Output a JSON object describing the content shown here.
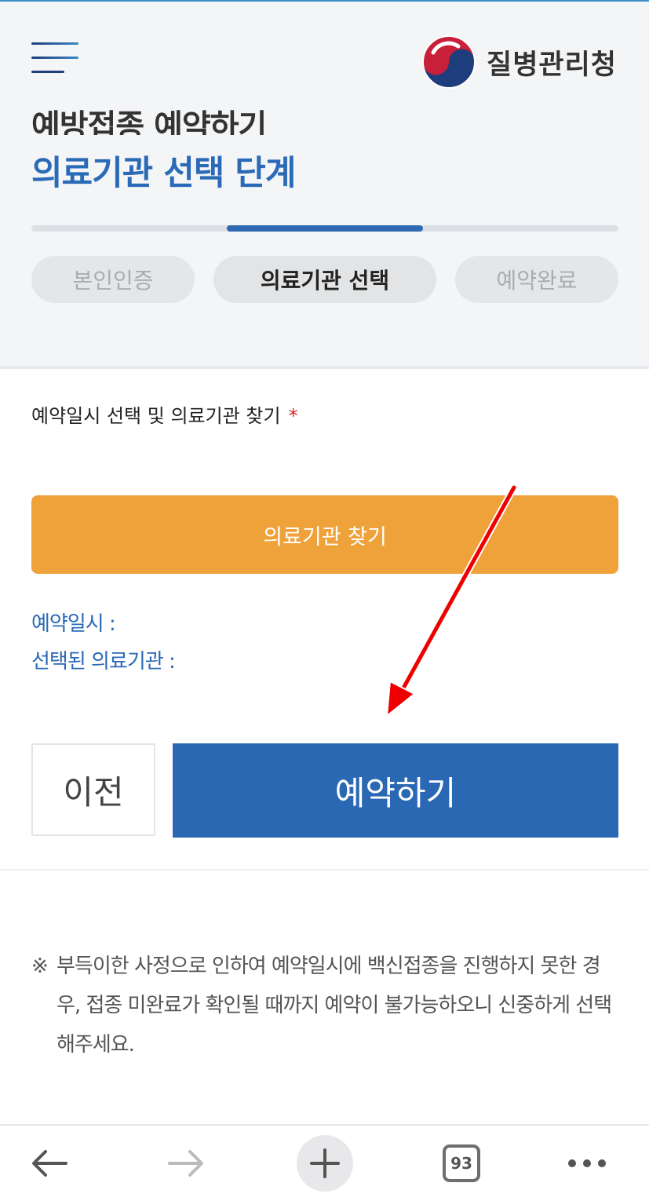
{
  "header": {
    "org_name": "질병관리청",
    "title_partial": "예방접종 예약하기",
    "stage_title": "의료기관 선택 단계"
  },
  "steps": [
    {
      "label": "본인인증",
      "state": "inactive"
    },
    {
      "label": "의료기관 선택",
      "state": "active"
    },
    {
      "label": "예약완료",
      "state": "inactive"
    }
  ],
  "progress": {
    "current_step": 2,
    "total_steps": 3
  },
  "form": {
    "section_label": "예약일시 선택 및 의료기관 찾기",
    "required_mark": "*",
    "find_button": "의료기관 찾기",
    "reservation_datetime_label": "예약일시 : ",
    "selected_hospital_label": "선택된 의료기관 : "
  },
  "actions": {
    "prev": "이전",
    "reserve": "예약하기"
  },
  "notice": {
    "mark": "※",
    "text": "부득이한 사정으로 인하여 예약일시에 백신접종을 진행하지 못한 경우, 접종 미완료가 확인될 때까지 예약이 불가능하오니 신중하게 선택해주세요."
  },
  "browser": {
    "tab_count": "93",
    "icons": [
      "back-arrow-icon",
      "forward-arrow-icon",
      "plus-icon",
      "tabs-icon",
      "more-icon"
    ]
  },
  "colors": {
    "brand_blue": "#2b68b3",
    "orange": "#f0a23a",
    "required_red": "#d72222",
    "annotation_red": "#ee0000"
  }
}
